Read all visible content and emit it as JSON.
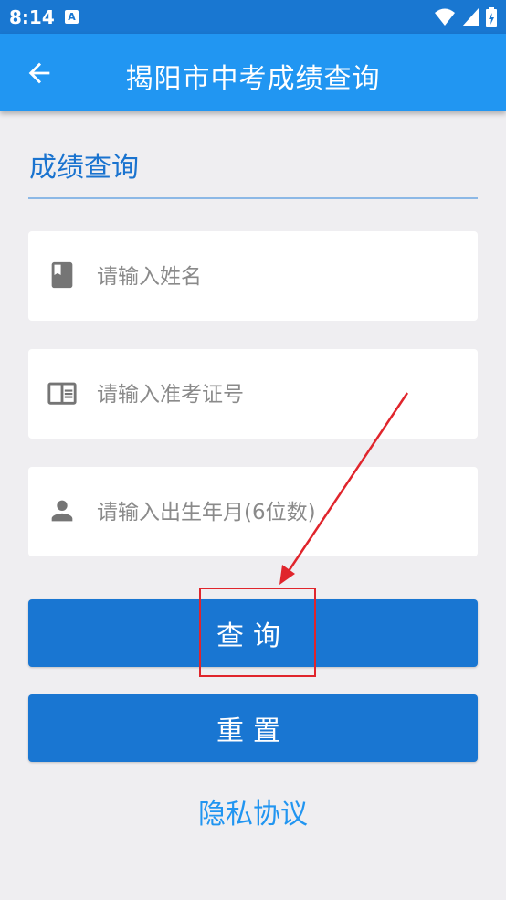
{
  "status_bar": {
    "time": "8:14",
    "notification_icon": "A"
  },
  "app_bar": {
    "title": "揭阳市中考成绩查询",
    "back_icon": "arrow-left-icon"
  },
  "section": {
    "title": "成绩查询"
  },
  "form": {
    "name_placeholder": "请输入姓名",
    "exam_id_placeholder": "请输入准考证号",
    "birth_placeholder": "请输入出生年月(6位数)",
    "name_icon": "book-icon",
    "exam_id_icon": "id-card-icon",
    "birth_icon": "person-icon"
  },
  "buttons": {
    "query_label": "查询",
    "reset_label": "重置"
  },
  "privacy": {
    "label": "隐私协议"
  },
  "colors": {
    "status_bar": "#1977d1",
    "app_bar": "#2196f2",
    "button": "#1976d2",
    "link": "#2195f1",
    "annotation": "#e0252c",
    "background": "#efeef1"
  }
}
